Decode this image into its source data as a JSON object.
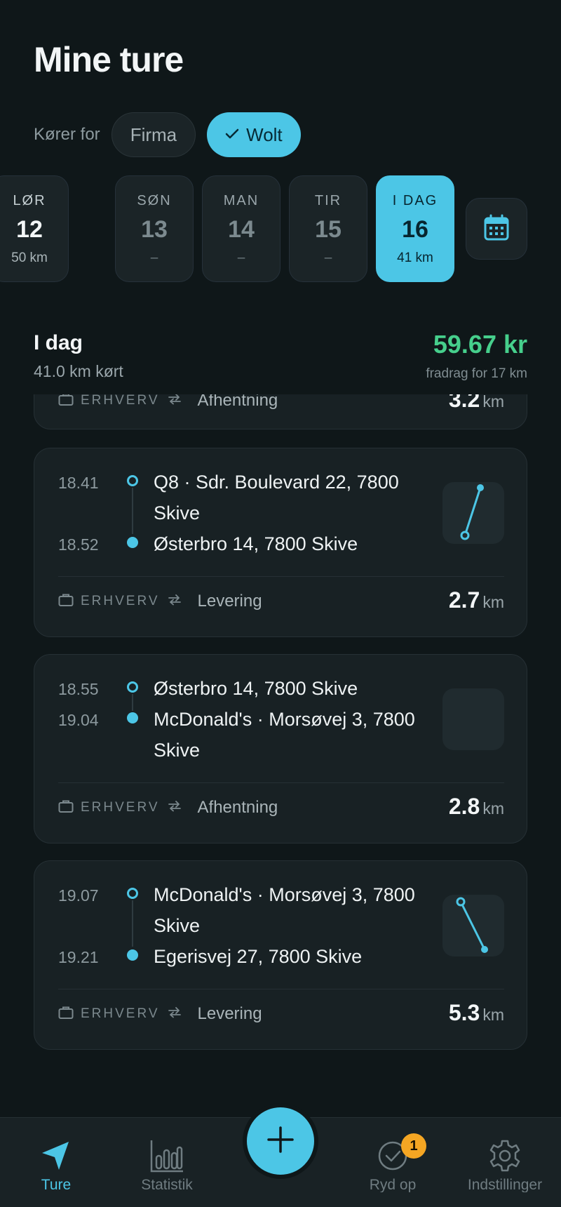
{
  "page": {
    "title": "Mine ture"
  },
  "driving_for": {
    "label": "Kører for",
    "options": [
      {
        "label": "Firma",
        "selected": false
      },
      {
        "label": "Wolt",
        "selected": true
      }
    ]
  },
  "days": [
    {
      "name": "LØR",
      "date": "12",
      "km": "50 km"
    },
    {
      "name": "SØN",
      "date": "13",
      "km": "–"
    },
    {
      "name": "MAN",
      "date": "14",
      "km": "–"
    },
    {
      "name": "TIR",
      "date": "15",
      "km": "–"
    },
    {
      "name": "I DAG",
      "date": "16",
      "km": "41 km"
    }
  ],
  "summary": {
    "title": "I dag",
    "distance": "41.0 km kørt",
    "amount": "59.67 kr",
    "note": "fradrag for 17 km"
  },
  "trips": [
    {
      "category": "ERHVERV",
      "mode": "Afhentning",
      "distance": "3.2",
      "unit": "km"
    },
    {
      "start_time": "18.41",
      "start_addr": "Q8 · Sdr. Boulevard 22, 7800 Skive",
      "end_time": "18.52",
      "end_addr": "Østerbro 14, 7800 Skive",
      "category": "ERHVERV",
      "mode": "Levering",
      "distance": "2.7",
      "unit": "km"
    },
    {
      "start_time": "18.55",
      "start_addr": "Østerbro 14, 7800 Skive",
      "end_time": "19.04",
      "end_addr": "McDonald's · Morsøvej 3, 7800 Skive",
      "category": "ERHVERV",
      "mode": "Afhentning",
      "distance": "2.8",
      "unit": "km"
    },
    {
      "start_time": "19.07",
      "start_addr": "McDonald's · Morsøvej 3, 7800 Skive",
      "end_time": "19.21",
      "end_addr": "Egerisvej 27, 7800 Skive",
      "category": "ERHVERV",
      "mode": "Levering",
      "distance": "5.3",
      "unit": "km"
    }
  ],
  "nav": {
    "items": [
      {
        "label": "Ture",
        "icon": "navigation-arrow-icon",
        "active": true
      },
      {
        "label": "Statistik",
        "icon": "bar-chart-icon",
        "active": false
      },
      {
        "label": "Ryd op",
        "icon": "check-circle-icon",
        "active": false,
        "badge": "1"
      },
      {
        "label": "Indstillinger",
        "icon": "gear-icon",
        "active": false
      }
    ],
    "fab_icon": "plus-icon"
  },
  "colors": {
    "accent": "#4cc6e6",
    "amount": "#46cf8c",
    "badge": "#f5a623",
    "background": "#0f1719"
  }
}
